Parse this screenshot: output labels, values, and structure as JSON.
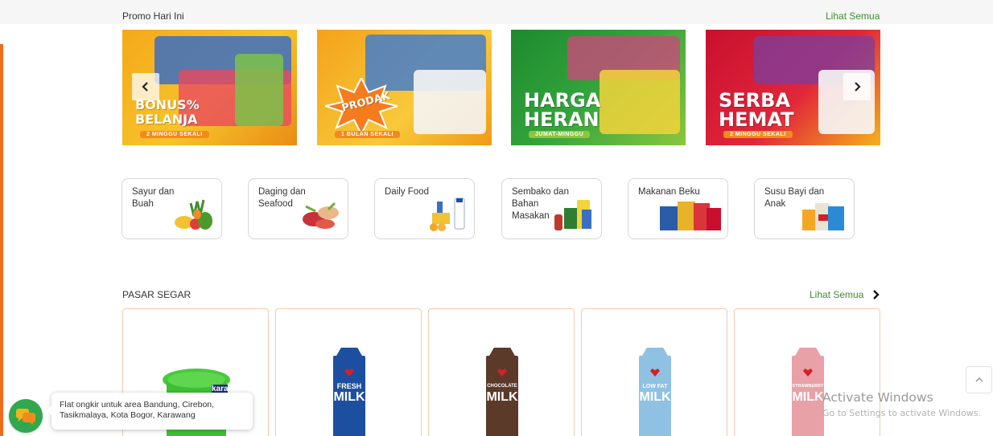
{
  "promo": {
    "title": "Promo Hari Ini",
    "see_all": "Lihat Semua",
    "banners": [
      {
        "line1": "BONUS%",
        "line2": "BELANJA",
        "tag": "2 MINGGU SEKALI"
      },
      {
        "line1": "PRODAK",
        "line2": "",
        "tag": "1 BULAN SEKALI"
      },
      {
        "line1": "HARGA",
        "line2": "HERAN",
        "tag": "JUMAT-MINGGU"
      },
      {
        "line1": "SERBA",
        "line2": "HEMAT",
        "tag": "2 MINGGU SEKALI"
      }
    ]
  },
  "categories": [
    {
      "label": "Sayur dan Buah"
    },
    {
      "label": "Daging dan Seafood"
    },
    {
      "label": "Daily Food"
    },
    {
      "label": "Sembako dan Bahan Masakan"
    },
    {
      "label": "Makanan Beku"
    },
    {
      "label": "Susu Bayi dan Anak"
    }
  ],
  "pasar": {
    "title": "PASAR SEGAR",
    "see_all": "Lihat Semua",
    "products": [
      {
        "brand": "kara",
        "type": "tub"
      },
      {
        "brand": "FRESH",
        "milk": "MILK",
        "color": "#1d4fa0"
      },
      {
        "brand": "CHOCOLATE",
        "milk": "MILK",
        "color": "#5b3a2a"
      },
      {
        "brand": "LOW FAT",
        "milk": "MILK",
        "color": "#8fc1e3"
      },
      {
        "brand": "STRAWBERRY",
        "milk": "MILK",
        "color": "#e8a1a6"
      }
    ]
  },
  "watermark": {
    "title": "Activate Windows",
    "subtitle": "Go to Settings to activate Windows."
  },
  "chat": {
    "message": "Flat ongkir untuk area Bandung, Cirebon, Tasikmalaya, Kota Bogor, Karawang"
  },
  "colors": {
    "accent_green": "#3d8f2f",
    "accent_orange": "#f26b1d",
    "chat_green": "#2fa84f"
  }
}
